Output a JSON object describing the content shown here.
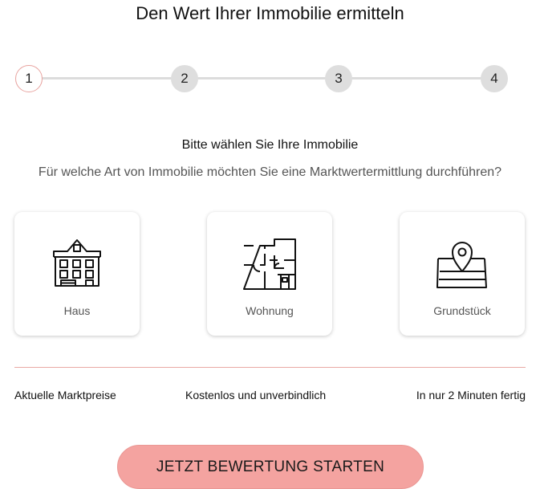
{
  "header": {
    "title": "Den Wert Ihrer Immobilie ermitteln"
  },
  "stepper": {
    "current_step": 1,
    "steps": [
      {
        "label": "1"
      },
      {
        "label": "2"
      },
      {
        "label": "3"
      },
      {
        "label": "4"
      }
    ]
  },
  "question": {
    "heading": "Bitte wählen Sie Ihre Immobilie",
    "text": "Für welche Art von Immobilie möchten Sie eine Marktwertermittlung durchführen?"
  },
  "options": [
    {
      "label": "Haus",
      "icon": "house-icon"
    },
    {
      "label": "Wohnung",
      "icon": "floorplan-icon"
    },
    {
      "label": "Grundstück",
      "icon": "land-plot-icon"
    }
  ],
  "features": [
    "Aktuelle Marktpreise",
    "Kostenlos und unverbindlich",
    "In nur 2 Minuten fertig"
  ],
  "cta": {
    "label": "JETZT BEWERTUNG STARTEN"
  },
  "colors": {
    "accent": "#f4a3a0",
    "active_step_border": "#e8a39f",
    "inactive_step": "#dedede",
    "divider": "#e9a9a5"
  }
}
